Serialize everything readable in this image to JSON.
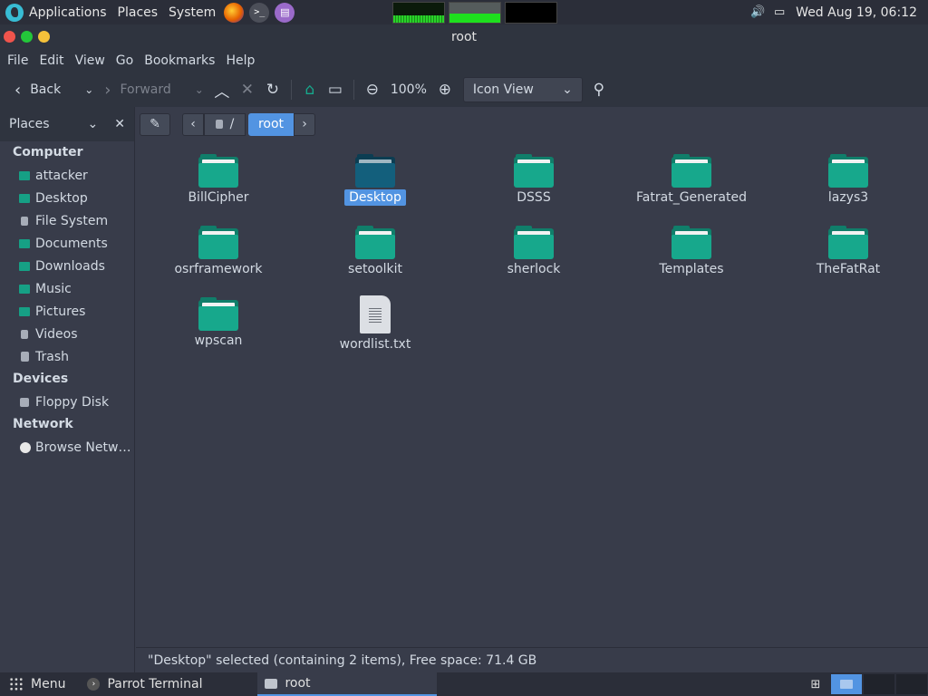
{
  "top_panel": {
    "menus": [
      "Applications",
      "Places",
      "System"
    ],
    "datetime": "Wed Aug 19, 06:12"
  },
  "window": {
    "title": "root"
  },
  "menubar": [
    "File",
    "Edit",
    "View",
    "Go",
    "Bookmarks",
    "Help"
  ],
  "toolbar": {
    "back": "Back",
    "forward": "Forward",
    "zoom": "100%",
    "view_mode": "Icon View"
  },
  "sidebar": {
    "title": "Places",
    "sections": {
      "computer": "Computer",
      "devices": "Devices",
      "network": "Network"
    },
    "computer_items": [
      "attacker",
      "Desktop",
      "File System",
      "Documents",
      "Downloads",
      "Music",
      "Pictures",
      "Videos",
      "Trash"
    ],
    "device_items": [
      "Floppy Disk"
    ],
    "network_items": [
      "Browse Netw…"
    ]
  },
  "location": {
    "root_label": "/",
    "current": "root"
  },
  "files": [
    {
      "name": "BillCipher",
      "type": "folder"
    },
    {
      "name": "Desktop",
      "type": "folder",
      "selected": true
    },
    {
      "name": "DSSS",
      "type": "folder"
    },
    {
      "name": "Fatrat_Generated",
      "type": "folder"
    },
    {
      "name": "lazys3",
      "type": "folder"
    },
    {
      "name": "osrframework",
      "type": "folder"
    },
    {
      "name": "setoolkit",
      "type": "folder"
    },
    {
      "name": "sherlock",
      "type": "folder"
    },
    {
      "name": "Templates",
      "type": "folder"
    },
    {
      "name": "TheFatRat",
      "type": "folder"
    },
    {
      "name": "wpscan",
      "type": "folder"
    },
    {
      "name": "wordlist.txt",
      "type": "text"
    }
  ],
  "status": "\"Desktop\" selected (containing 2 items), Free space: 71.4 GB",
  "bottom_panel": {
    "menu": "Menu",
    "tasks": [
      "Parrot Terminal",
      "root"
    ]
  },
  "colors": {
    "accent": "#5294e2",
    "folder": "#17a88c",
    "folder_selected": "#135f7c"
  }
}
